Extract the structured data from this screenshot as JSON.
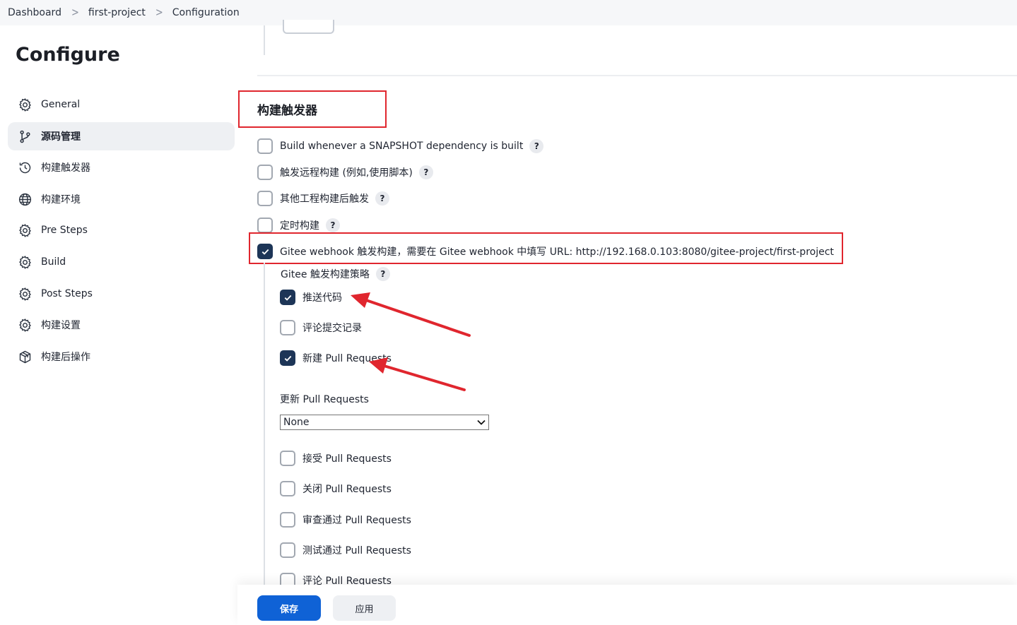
{
  "breadcrumb": [
    "Dashboard",
    "first-project",
    "Configuration"
  ],
  "sidebar": {
    "title": "Configure",
    "items": [
      {
        "label": "General",
        "icon": "gear-icon"
      },
      {
        "label": "源码管理",
        "icon": "git-branch-icon"
      },
      {
        "label": "构建触发器",
        "icon": "clock-icon"
      },
      {
        "label": "构建环境",
        "icon": "globe-icon"
      },
      {
        "label": "Pre Steps",
        "icon": "gear-icon"
      },
      {
        "label": "Build",
        "icon": "gear-icon"
      },
      {
        "label": "Post Steps",
        "icon": "gear-icon"
      },
      {
        "label": "构建设置",
        "icon": "gear-icon"
      },
      {
        "label": "构建后操作",
        "icon": "package-icon"
      }
    ],
    "active_index": 1
  },
  "main": {
    "section_title": "构建触发器",
    "triggers": [
      {
        "label": "Build whenever a SNAPSHOT dependency is built",
        "checked": false,
        "help": "?"
      },
      {
        "label": "触发远程构建 (例如,使用脚本)",
        "checked": false,
        "help": "?"
      },
      {
        "label": "其他工程构建后触发",
        "checked": false,
        "help": "?"
      },
      {
        "label": "定时构建",
        "checked": false,
        "help": "?"
      },
      {
        "label": "Gitee webhook 触发构建，需要在 Gitee webhook 中填写 URL: http://192.168.0.103:8080/gitee-project/first-project",
        "checked": true
      }
    ],
    "strategy_label": "Gitee 触发构建策略",
    "strategy_help": "?",
    "strategy_options": [
      {
        "label": "推送代码",
        "checked": true
      },
      {
        "label": "评论提交记录",
        "checked": false
      },
      {
        "label": "新建 Pull Requests",
        "checked": true
      }
    ],
    "update_pr_label": "更新 Pull Requests",
    "update_pr_value": "None",
    "pr_options": [
      {
        "label": "接受 Pull Requests",
        "checked": false
      },
      {
        "label": "关闭 Pull Requests",
        "checked": false
      },
      {
        "label": "审查通过 Pull Requests",
        "checked": false
      },
      {
        "label": "测试通过 Pull Requests",
        "checked": false
      },
      {
        "label": "评论 Pull Requests",
        "checked": false
      }
    ]
  },
  "footer": {
    "save_label": "保存",
    "apply_label": "应用"
  },
  "colors": {
    "annotation_red": "#e0262e",
    "checkbox_checked": "#1d3557",
    "primary_button": "#0f62d6"
  }
}
